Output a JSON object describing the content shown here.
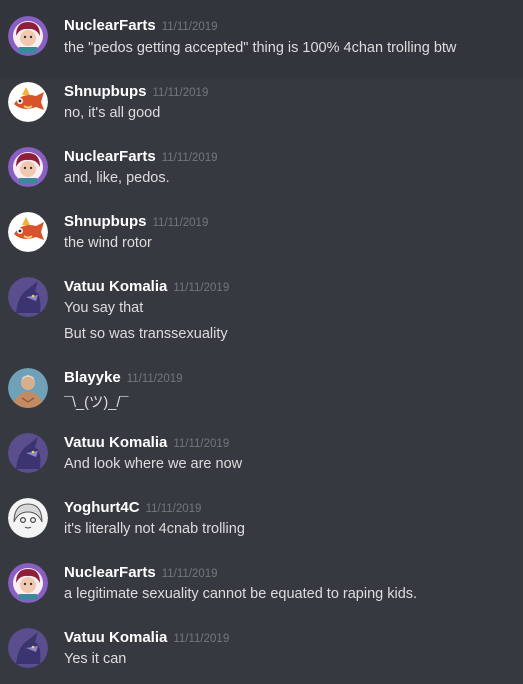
{
  "messages": [
    {
      "author": "NuclearFarts",
      "time": "11/11/2019",
      "lines": [
        "the \"pedos getting accepted\" thing is 100% 4chan trolling btw"
      ],
      "avatar": "nuclearfarts-avatar"
    },
    {
      "author": "Shnupbups",
      "time": "11/11/2019",
      "lines": [
        "no, it's all good"
      ],
      "avatar": "shnupbups-avatar"
    },
    {
      "author": "NuclearFarts",
      "time": "11/11/2019",
      "lines": [
        "and, like, pedos."
      ],
      "avatar": "nuclearfarts-avatar"
    },
    {
      "author": "Shnupbups",
      "time": "11/11/2019",
      "lines": [
        "the wind rotor"
      ],
      "avatar": "shnupbups-avatar"
    },
    {
      "author": "Vatuu Komalia",
      "time": "11/11/2019",
      "lines": [
        "You say that",
        "But so was transsexuality"
      ],
      "avatar": "vatuu-avatar"
    },
    {
      "author": "Blayyke",
      "time": "11/11/2019",
      "lines": [
        "¯\\_(ツ)_/¯"
      ],
      "avatar": "blayyke-avatar"
    },
    {
      "author": "Vatuu Komalia",
      "time": "11/11/2019",
      "lines": [
        "And look where we are now"
      ],
      "avatar": "vatuu-avatar"
    },
    {
      "author": "Yoghurt4C",
      "time": "11/11/2019",
      "lines": [
        "it's literally not 4cnab trolling"
      ],
      "avatar": "yoghurt-avatar"
    },
    {
      "author": "NuclearFarts",
      "time": "11/11/2019",
      "lines": [
        "a legitimate sexuality cannot be equated to raping kids."
      ],
      "avatar": "nuclearfarts-avatar"
    },
    {
      "author": "Vatuu Komalia",
      "time": "11/11/2019",
      "lines": [
        "Yes it can"
      ],
      "avatar": "vatuu-avatar"
    }
  ],
  "colors": {
    "background": "#36393f",
    "username": "#ffffff",
    "timestamp": "#72767d",
    "text": "#dcddde"
  }
}
